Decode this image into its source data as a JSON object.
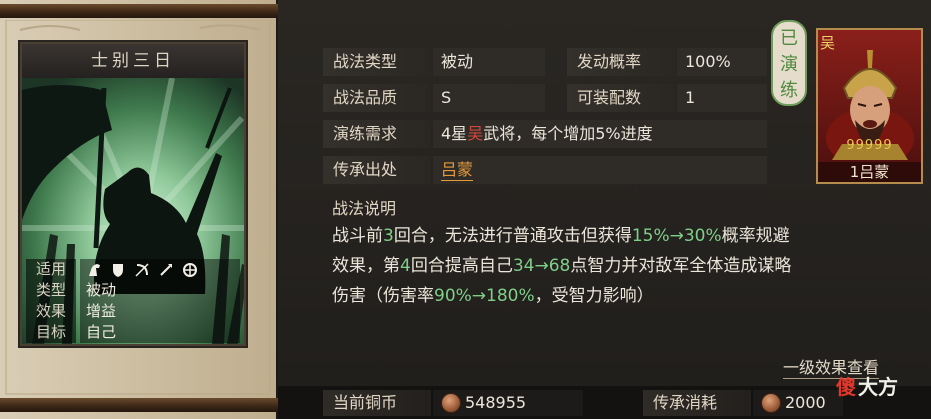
{
  "tactic_card": {
    "title": "士别三日",
    "props": {
      "applicable_label": "适用",
      "type_label": "类型",
      "type_value": "被动",
      "effect_label": "效果",
      "effect_value": "增益",
      "target_label": "目标",
      "target_value": "自己"
    },
    "arm_icons": [
      "cavalry-icon",
      "shield-icon",
      "archer-icon",
      "spear-icon",
      "siege-icon"
    ]
  },
  "details": {
    "type_label": "战法类型",
    "type_value": "被动",
    "trigger_label": "发动概率",
    "trigger_value": "100%",
    "quality_label": "战法品质",
    "quality_value": "S",
    "slots_label": "可装配数",
    "slots_value": "1",
    "training_label": "演练需求",
    "training_prefix": "4星",
    "training_faction": "吴",
    "training_suffix": "武将，每个增加5%进度",
    "source_label": "传承出处",
    "source_value": "吕蒙"
  },
  "description": {
    "title": "战法说明",
    "p1": "战斗前",
    "p1_rounds": "3",
    "p2": "回合，无法进行普通攻击但获得",
    "p2_rate": "15%→30%",
    "p3": "概率规避",
    "line2_a": "效果，第",
    "line2_round": "4",
    "line2_b": "回合提高自己",
    "line2_int": "34→68",
    "line2_c": "点智力并对敌军全体造成谋略",
    "line3_a": "伤害（伤害率",
    "line3_rate": "90%→180%",
    "line3_b": "，受智力影响）"
  },
  "level_link": "一级效果查看",
  "bottom": {
    "coins_label": "当前铜币",
    "coins_value": "548955",
    "cost_label": "传承消耗",
    "cost_value": "2000"
  },
  "mastered_badge": "已演练",
  "general": {
    "faction": "吴",
    "name": "1吕蒙",
    "stars": "99999"
  },
  "watermark": {
    "a": "傻",
    "b": "大方"
  },
  "colors": {
    "highlight_green": "#7fcf88",
    "faction_red": "#d34a3d",
    "source_orange": "#e39a3b"
  }
}
